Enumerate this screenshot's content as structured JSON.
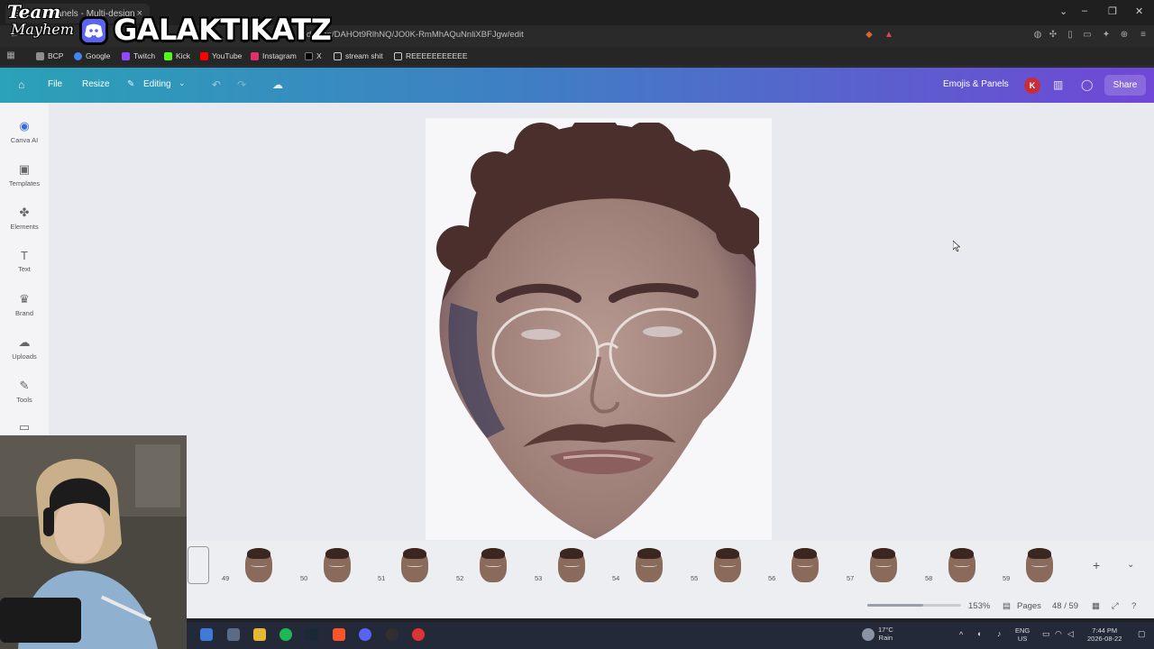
{
  "browser": {
    "tab_title": "Emojis & Panels - Multi-design",
    "url": "design/DAHOt9RlhNQ/JO0K-RmMhAQuNnliXBFJgw/edit",
    "bookmarks": [
      {
        "label": "BCP",
        "icon": "bcp-icon",
        "color": "#8e8e8e"
      },
      {
        "label": "Google",
        "icon": "google-icon",
        "color": "#4285f4"
      },
      {
        "label": "Twitch",
        "icon": "twitch-icon",
        "color": "#9146ff"
      },
      {
        "label": "Kick",
        "icon": "kick-icon",
        "color": "#53fc18"
      },
      {
        "label": "YouTube",
        "icon": "youtube-icon",
        "color": "#ff0000"
      },
      {
        "label": "Instagram",
        "icon": "instagram-icon",
        "color": "#e1306c"
      },
      {
        "label": "X",
        "icon": "x-icon",
        "color": "#000000"
      },
      {
        "label": "stream shit",
        "icon": "folder-icon",
        "color": "#cccccc"
      },
      {
        "label": "REEEEEEEEEEE",
        "icon": "folder-icon",
        "color": "#cccccc"
      }
    ]
  },
  "canva": {
    "menu": {
      "file": "File",
      "resize": "Resize",
      "editing": "Editing"
    },
    "design_title": "Emojis & Panels",
    "avatar_initial": "K",
    "share_label": "Share",
    "sidebar": [
      {
        "label": "Canva AI",
        "icon": "canva-ai-icon"
      },
      {
        "label": "Templates",
        "icon": "templates-icon"
      },
      {
        "label": "Elements",
        "icon": "elements-icon"
      },
      {
        "label": "Text",
        "icon": "text-icon"
      },
      {
        "label": "Brand",
        "icon": "brand-icon"
      },
      {
        "label": "Uploads",
        "icon": "uploads-icon"
      },
      {
        "label": "Tools",
        "icon": "tools-icon"
      },
      {
        "label": "",
        "icon": "projects-icon"
      }
    ],
    "filmstrip": {
      "pages": [
        "49",
        "50",
        "51",
        "52",
        "53",
        "54",
        "55",
        "56",
        "57",
        "58",
        "59"
      ]
    },
    "statusbar": {
      "zoom_label": "153%",
      "zoom_level": 0.6,
      "pages_label": "Pages",
      "page_count": "48 / 59"
    }
  },
  "taskbar": {
    "weather_temp": "17°C",
    "weather_desc": "Rain",
    "lang": "ENG",
    "region": "US",
    "time": "7:44 PM",
    "date": "2026-08-22"
  },
  "overlay": {
    "team_line1": "Team",
    "team_line2": "Mayhem",
    "streamer_name": "GALAKTIKATZ"
  }
}
